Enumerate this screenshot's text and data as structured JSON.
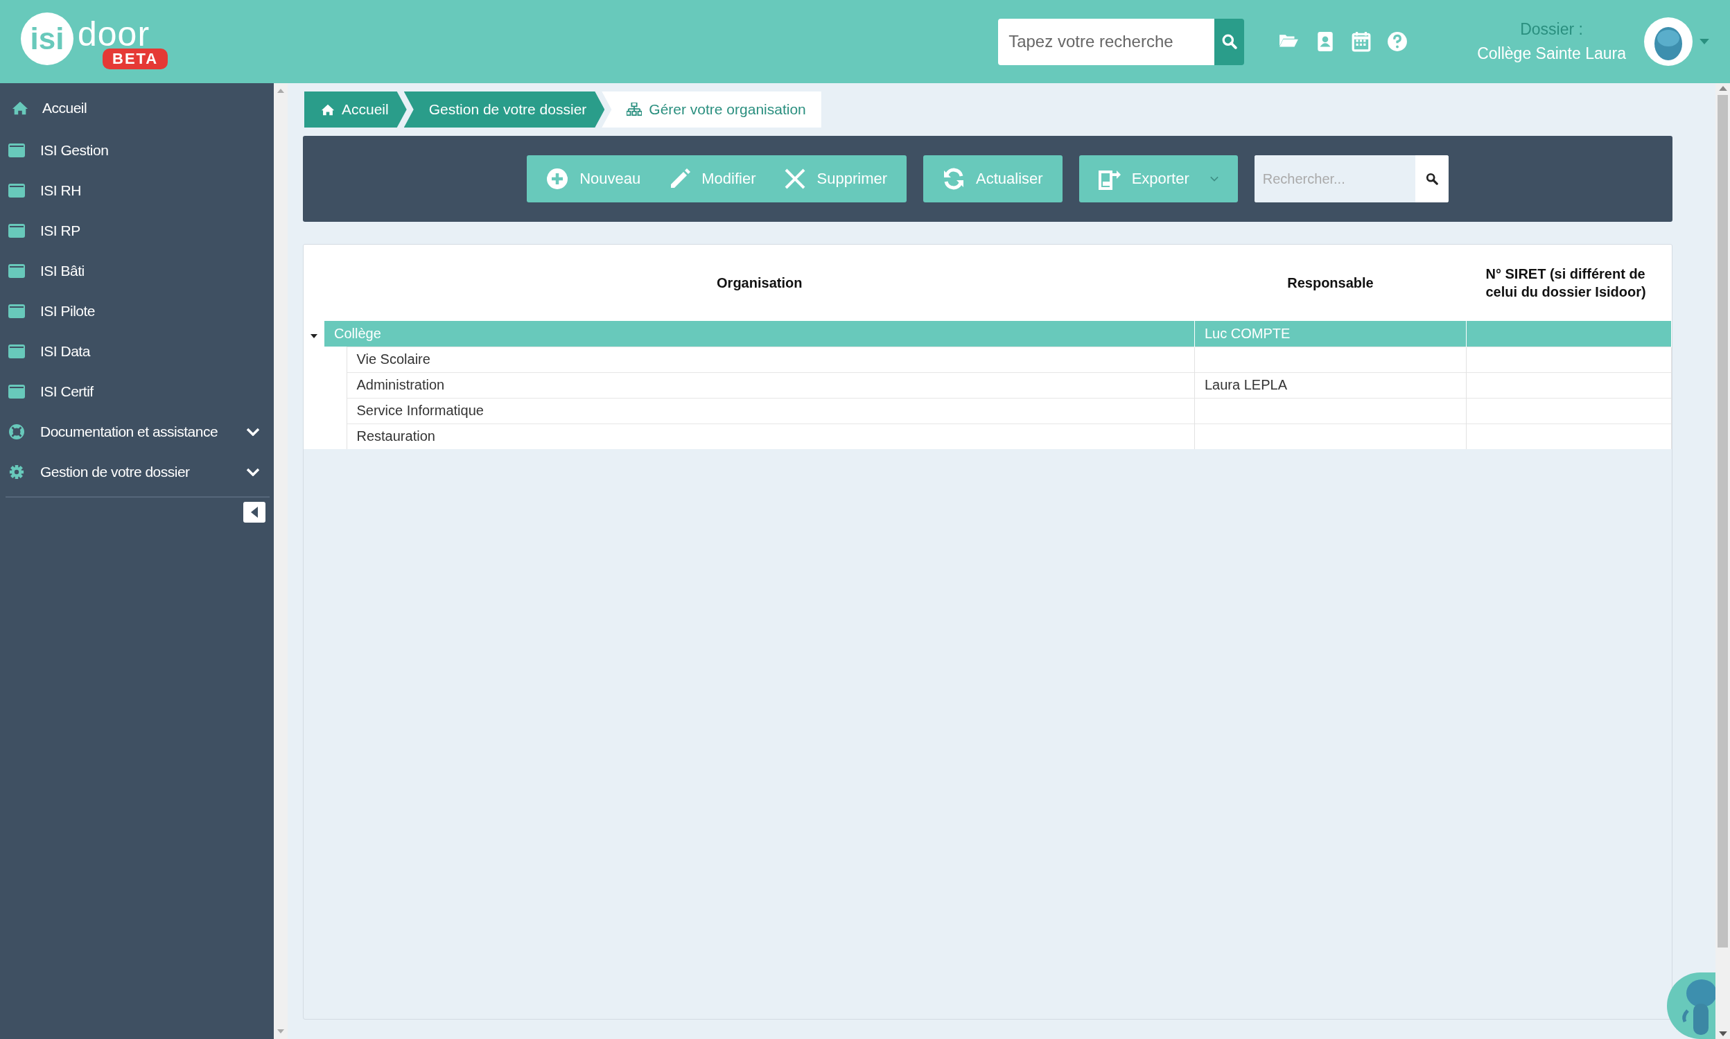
{
  "header": {
    "logo": {
      "part_1": "isi",
      "part_2": "door",
      "badge": "BETA"
    },
    "search": {
      "placeholder": "Tapez votre recherche"
    },
    "tools": [
      {
        "kind": "folder"
      },
      {
        "kind": "contacts"
      },
      {
        "kind": "calendar"
      },
      {
        "kind": "help"
      }
    ],
    "dossier": {
      "label": "Dossier :",
      "value": "Collège Sainte Laura"
    }
  },
  "sidebar": {
    "items": [
      {
        "kind": "home",
        "label": "Accueil"
      },
      {
        "kind": "module",
        "label": "ISI Gestion"
      },
      {
        "kind": "module",
        "label": "ISI RH"
      },
      {
        "kind": "module",
        "label": "ISI RP"
      },
      {
        "kind": "module",
        "label": "ISI Bâti"
      },
      {
        "kind": "module",
        "label": "ISI Pilote"
      },
      {
        "kind": "module",
        "label": "ISI Data"
      },
      {
        "kind": "module",
        "label": "ISI Certif"
      },
      {
        "kind": "help",
        "label": "Documentation et assistance",
        "expanded": false
      },
      {
        "kind": "settings",
        "label": "Gestion de votre dossier",
        "expanded": false
      }
    ]
  },
  "breadcrumb": [
    {
      "kind": "home",
      "label": "Accueil",
      "selected": false
    },
    {
      "kind": "plain",
      "label": "Gestion de votre dossier",
      "selected": false
    },
    {
      "kind": "sitemap",
      "label": "Gérer votre organisation",
      "selected": true
    }
  ],
  "toolbar": {
    "groups": [
      [
        {
          "kind": "plus",
          "label": "Nouveau"
        },
        {
          "kind": "pencil",
          "label": "Modifier"
        },
        {
          "kind": "cross",
          "label": "Supprimer"
        }
      ],
      [
        {
          "kind": "refresh",
          "label": "Actualiser"
        }
      ],
      [
        {
          "kind": "export",
          "label": "Exporter",
          "dropdown": true
        }
      ]
    ],
    "search": {
      "placeholder": "Rechercher..."
    }
  },
  "table": {
    "columns": [
      "Organisation",
      "Responsable",
      "N° SIRET (si différent de celui du dossier Isidoor)"
    ],
    "rows": [
      {
        "cells": [
          "Collège",
          "Luc COMPTE",
          ""
        ],
        "expanded": true,
        "selected": true,
        "children": [
          {
            "cells": [
              "Vie Scolaire",
              "",
              ""
            ],
            "selected": false
          },
          {
            "cells": [
              "Administration",
              "Laura LEPLA",
              ""
            ],
            "selected": false
          },
          {
            "cells": [
              "Service Informatique",
              "",
              ""
            ],
            "selected": false
          },
          {
            "cells": [
              "Restauration",
              "",
              ""
            ],
            "selected": false
          }
        ]
      }
    ]
  }
}
